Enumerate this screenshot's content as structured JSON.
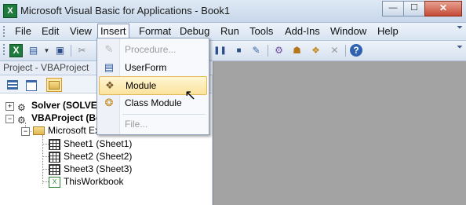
{
  "window": {
    "title": "Microsoft Visual Basic for Applications - Book1",
    "min_glyph": "—",
    "max_glyph": "☐",
    "close_glyph": "✕"
  },
  "menubar": {
    "items": [
      "File",
      "Edit",
      "View",
      "Insert",
      "Format",
      "Debug",
      "Run",
      "Tools",
      "Add-Ins",
      "Window",
      "Help"
    ],
    "active": "Insert"
  },
  "insert_menu": {
    "items": [
      {
        "label": "Procedure...",
        "enabled": false,
        "icon": "procedure-icon"
      },
      {
        "label": "UserForm",
        "enabled": true,
        "icon": "userform-icon"
      },
      {
        "label": "Module",
        "enabled": true,
        "highlighted": true,
        "icon": "module-icon"
      },
      {
        "label": "Class Module",
        "enabled": true,
        "icon": "class-module-icon"
      },
      {
        "label": "File...",
        "enabled": false
      }
    ]
  },
  "project_pane": {
    "title": "Project - VBAProject",
    "tree": {
      "solver": "Solver (SOLVE",
      "vbaproject": "VBAProject (Bo",
      "objects_folder": "Microsoft Exce",
      "sheets": [
        "Sheet1 (Sheet1)",
        "Sheet2 (Sheet2)",
        "Sheet3 (Sheet3)"
      ],
      "workbook": "ThisWorkbook"
    }
  },
  "colors": {
    "menu_highlight": "#fbe29c",
    "code_area": "#a3a3a3",
    "chrome": "#d8e3f1"
  }
}
